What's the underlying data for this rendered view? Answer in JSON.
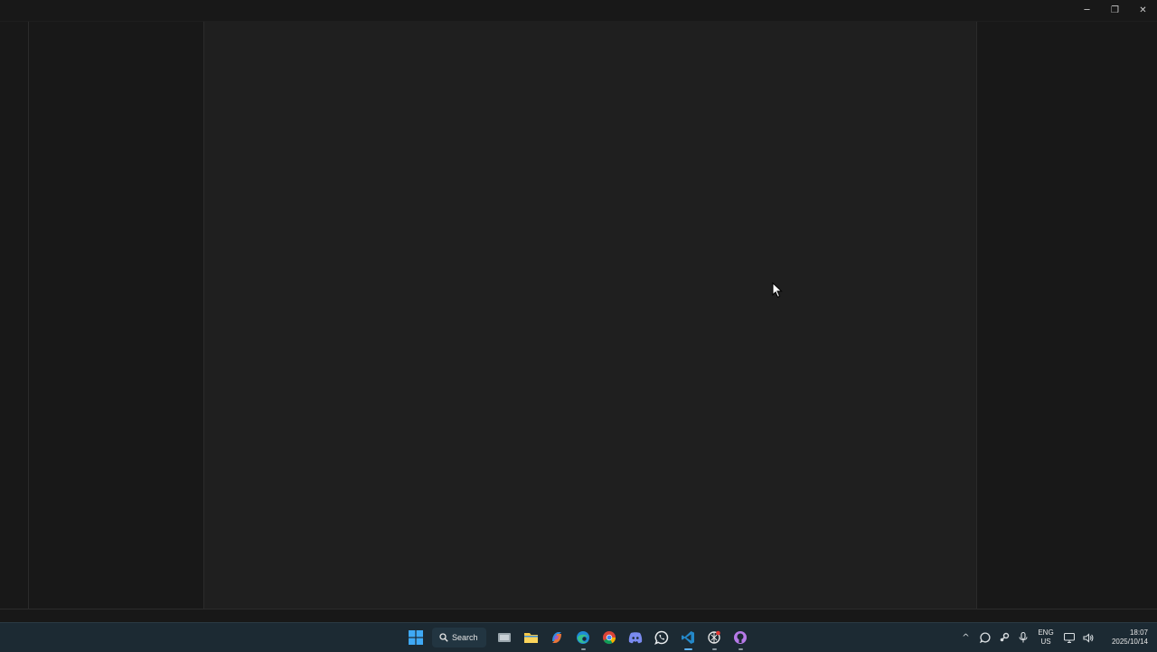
{
  "window": {
    "controls": {
      "minimize_glyph": "─",
      "restore_glyph": "❐",
      "close_glyph": "✕"
    }
  },
  "taskbar": {
    "search_label": "Search",
    "pinned": [
      {
        "name": "windows-start-icon"
      },
      {
        "name": "search-icon"
      },
      {
        "name": "task-view-icon"
      },
      {
        "name": "file-explorer-icon"
      },
      {
        "name": "copilot-icon"
      },
      {
        "name": "edge-icon"
      },
      {
        "name": "chrome-icon"
      },
      {
        "name": "discord-icon"
      },
      {
        "name": "whatsapp-icon"
      },
      {
        "name": "vscode-icon"
      },
      {
        "name": "openai-icon"
      },
      {
        "name": "github-copilot-icon"
      }
    ],
    "tray": {
      "chevron_glyph": "^",
      "language_line1": "ENG",
      "language_line2": "US",
      "time": "18:07",
      "date": "2025/10/14"
    },
    "colors": {
      "background": "#1c2a33",
      "active_indicator": "#5fb2f2"
    }
  },
  "editor": {
    "colors": {
      "editor_background": "#1f1f1f",
      "chrome_background": "#181818"
    }
  }
}
